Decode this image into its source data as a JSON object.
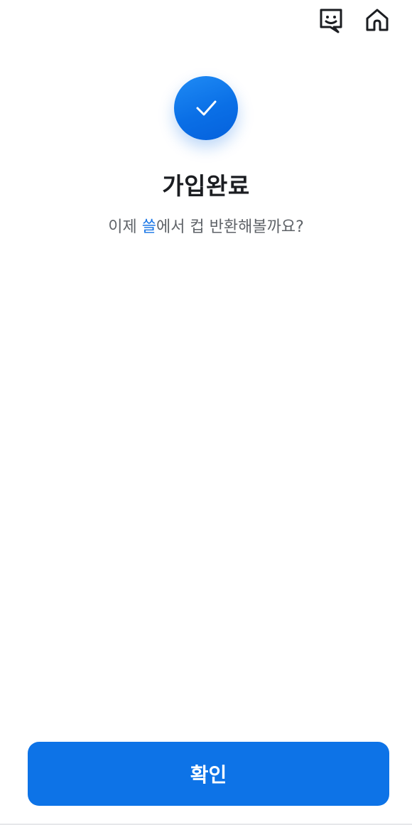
{
  "header": {
    "chat_icon": "chat-bubble-smile-icon",
    "home_icon": "home-icon"
  },
  "status": {
    "icon": "check-icon",
    "title": "가입완료",
    "subtitle_prefix": "이제 ",
    "subtitle_brand": "쓸",
    "subtitle_suffix": "에서 컵 반환해볼까요?"
  },
  "footer": {
    "confirm_label": "확인"
  },
  "colors": {
    "accent": "#0d73e7",
    "title": "#1b1d21",
    "subtitle": "#5f6368",
    "brand_text": "#1674e6"
  }
}
